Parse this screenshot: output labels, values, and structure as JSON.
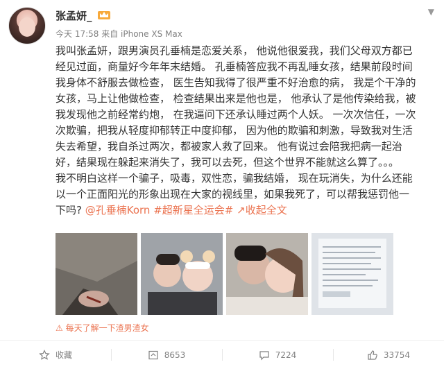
{
  "post": {
    "username": "张孟妍_",
    "meta": "今天 17:58 来自 iPhone XS Max",
    "line1": "我叫张孟妍，跟男演员孔垂楠是恋爱关系， 他说他很爱我，我们父母双方都已",
    "line2": "经见过面，商量好今年年末结婚。 孔垂楠答应我不再乱睡女孩，结果前段时间",
    "line3": "我身体不舒服去做检查， 医生告知我得了很严重不好治愈的病， 我是个干净的",
    "line4": "女孩，马上让他做检查， 检查结果出来是他也是， 他承认了是他传染给我，被",
    "line5": "我发现他之前经常约炮， 在我逼问下还承认睡过两个人妖。 一次次信任，一次",
    "line6": "次欺骗，把我从轻度抑郁转正中度抑郁， 因为他的欺骗和刺激，导致我对生活",
    "line7": "失去希望，我自杀过两次，都被家人救了回来。 他有说过会陪我把病一起治",
    "line8": "好，结果现在躲起来消失了，我可以去死，但这个世界不能就这么算了。。。",
    "line9": "我不明白这样一个骗子，吸毒，双性恋，骗我结婚， 现在玩消失，为什么还能",
    "line10": "以一个正面阳光的形象出现在大家的视线里，如果我死了，可以帮我惩罚他一",
    "line11_prefix": "下吗? ",
    "mention": "@孔垂楠Korn",
    "hashtag": "#超新星全运会#",
    "collapse": "收起全文",
    "hint": "每天了解一下渣男渣女"
  },
  "actions": {
    "favorite": "收藏",
    "repost": "8653",
    "comment": "7224",
    "like": "33754"
  },
  "colors": {
    "accent": "#eb7350",
    "meta": "#808080"
  },
  "icons": [
    "vip-crown-icon",
    "chevron-down-icon",
    "favorite-star-icon",
    "repost-icon",
    "comment-icon",
    "like-thumb-icon",
    "link-icon",
    "hint-icon"
  ]
}
